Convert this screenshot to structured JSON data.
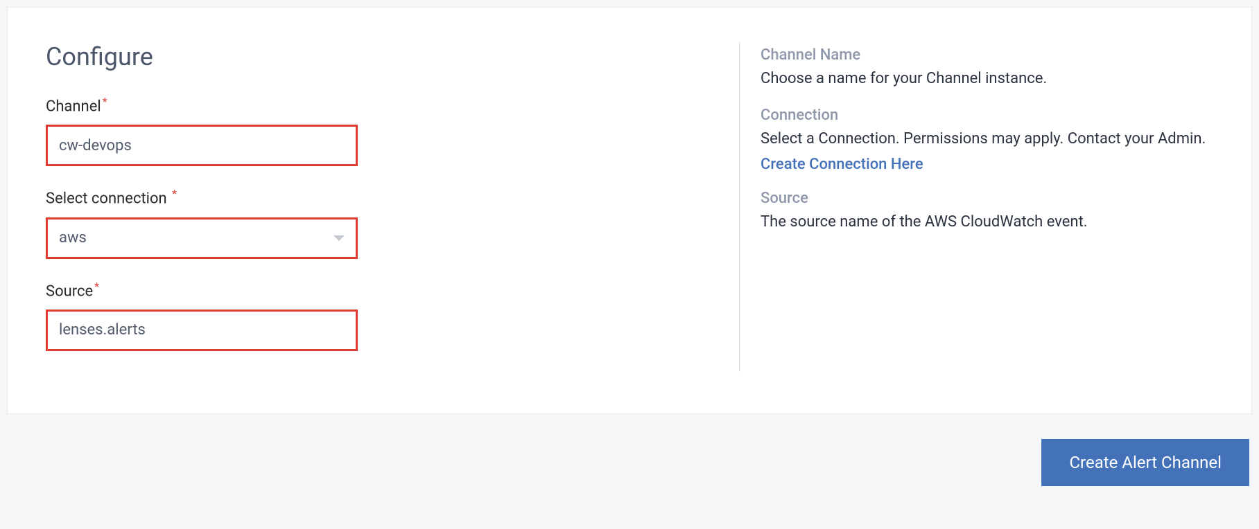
{
  "heading": "Configure",
  "form": {
    "channel": {
      "label": "Channel",
      "value": "cw-devops"
    },
    "connection": {
      "label": "Select connection",
      "value": "aws"
    },
    "source": {
      "label": "Source",
      "value": "lenses.alerts"
    }
  },
  "help": {
    "channel_name": {
      "title": "Channel Name",
      "text": "Choose a name for your Channel instance."
    },
    "connection": {
      "title": "Connection",
      "text": "Select a Connection. Permissions may apply. Contact your Admin.",
      "link": "Create Connection Here"
    },
    "source": {
      "title": "Source",
      "text": "The source name of the AWS CloudWatch event."
    }
  },
  "submit_label": "Create Alert Channel"
}
